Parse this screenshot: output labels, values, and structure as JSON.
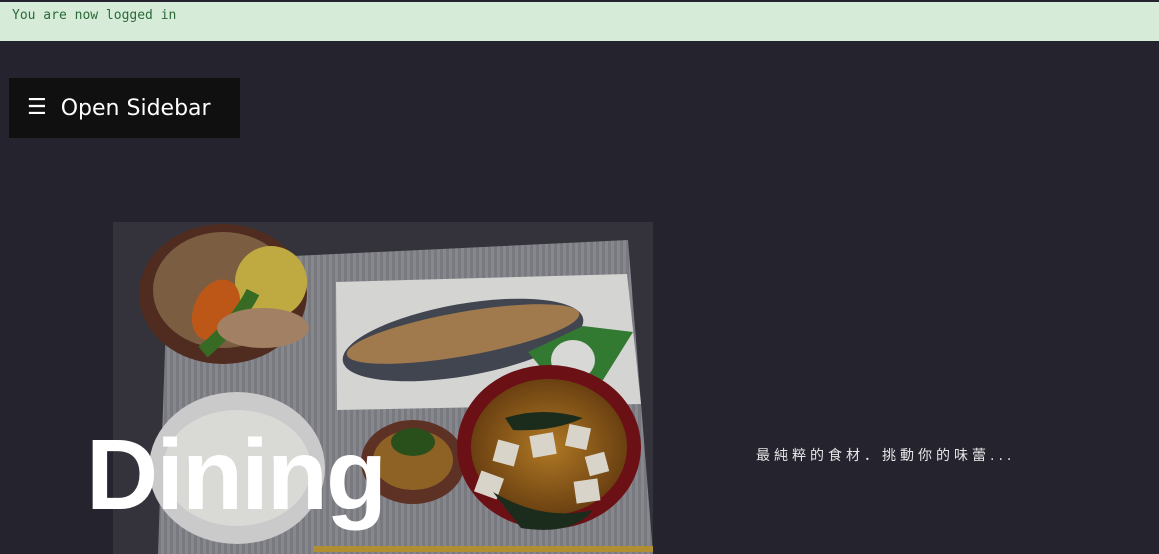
{
  "flash": {
    "message": "You are now logged in"
  },
  "toolbar": {
    "open_sidebar_icon": "☰",
    "open_sidebar_label": "Open Sidebar"
  },
  "hero": {
    "image_icon": "food-photo-icon",
    "title": "Dining",
    "tagline": "最純粹的食材．挑動你的味蕾..."
  },
  "colors": {
    "background": "#25232e",
    "flash_bg": "#d6ecd9",
    "flash_text": "#2b6a38",
    "button_bg": "#101010"
  }
}
